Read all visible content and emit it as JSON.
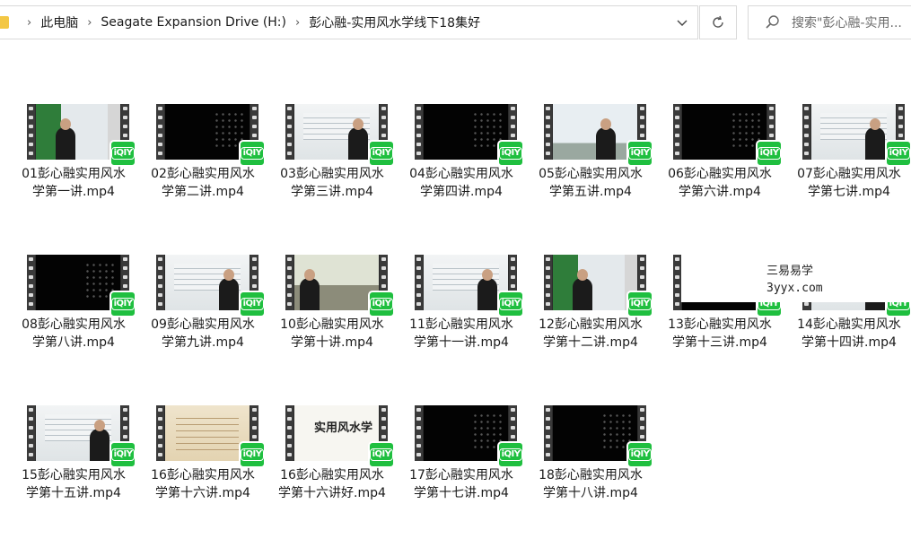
{
  "breadcrumb": {
    "items": [
      "此电脑",
      "Seagate Expansion Drive (H:)",
      "彭心融-实用风水学线下18集好"
    ]
  },
  "search": {
    "placeholder": "搜索\"彭心融-实用..."
  },
  "icons": {
    "folder": "folder-icon",
    "chevron": "chevron-right-icon",
    "dropdown": "chevron-down-icon",
    "refresh": "refresh-icon",
    "search": "search-icon",
    "player_badge": "iqiyi-icon"
  },
  "badge_text": "iQIY",
  "watermark": {
    "line1": "三易易学",
    "line2": "3yyx.com"
  },
  "files": [
    {
      "name": "01彭心融实用风水学第一讲.mp4",
      "thumb": "class2"
    },
    {
      "name": "02彭心融实用风水学第二讲.mp4",
      "thumb": "dark"
    },
    {
      "name": "03彭心融实用风水学第三讲.mp4",
      "thumb": "board"
    },
    {
      "name": "04彭心融实用风水学第四讲.mp4",
      "thumb": "dark"
    },
    {
      "name": "05彭心融实用风水学第五讲.mp4",
      "thumb": "class"
    },
    {
      "name": "06彭心融实用风水学第六讲.mp4",
      "thumb": "dark"
    },
    {
      "name": "07彭心融实用风水学第七讲.mp4",
      "thumb": "board"
    },
    {
      "name": "08彭心融实用风水学第八讲.mp4",
      "thumb": "dark"
    },
    {
      "name": "09彭心融实用风水学第九讲.mp4",
      "thumb": "board"
    },
    {
      "name": "10彭心融实用风水学第十讲.mp4",
      "thumb": "room"
    },
    {
      "name": "11彭心融实用风水学第十一讲.mp4",
      "thumb": "board"
    },
    {
      "name": "12彭心融实用风水学第十二讲.mp4",
      "thumb": "class2"
    },
    {
      "name": "13彭心融实用风水学第十三讲.mp4",
      "thumb": "dark"
    },
    {
      "name": "14彭心融实用风水学第十四讲.mp4",
      "thumb": "board"
    },
    {
      "name": "15彭心融实用风水学第十五讲.mp4",
      "thumb": "board"
    },
    {
      "name": "16彭心融实用风水学第十六讲.mp4",
      "thumb": "paper"
    },
    {
      "name": "16彭心融实用风水学第十六讲好.mp4",
      "thumb": "title",
      "title_text": "实用风水学"
    },
    {
      "name": "17彭心融实用风水学第十七讲.mp4",
      "thumb": "dark"
    },
    {
      "name": "18彭心融实用风水学第十八讲.mp4",
      "thumb": "dark"
    }
  ]
}
